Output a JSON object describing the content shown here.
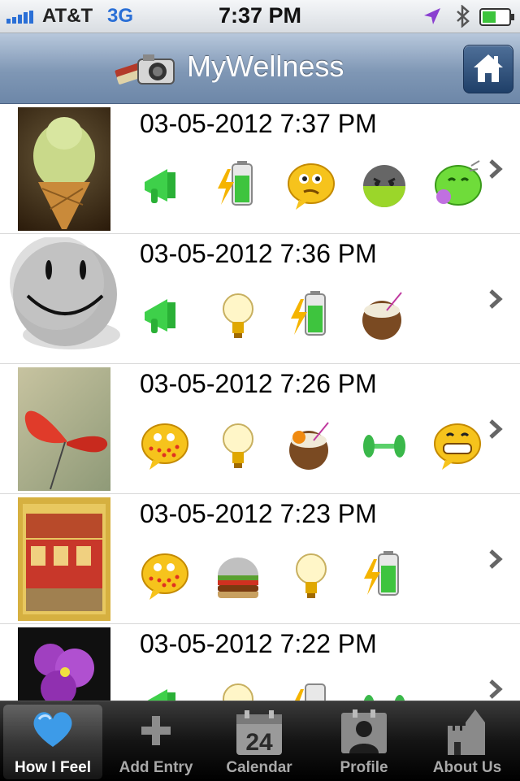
{
  "status_bar": {
    "carrier": "AT&T",
    "network": "3G",
    "time": "7:37 PM",
    "icons": [
      "signal-icon",
      "location-arrow-icon",
      "bluetooth-icon",
      "battery-icon"
    ]
  },
  "nav": {
    "title": "MyWellness",
    "home_icon": "home-icon",
    "logo_icon": "books-camera-logo"
  },
  "entries": [
    {
      "timestamp": "03-05-2012 7:37 PM",
      "thumbnail": "ice-cream-cone-photo",
      "icons": [
        "megaphone-icon",
        "battery-charge-icon",
        "thinking-face-icon",
        "sick-face-icon",
        "nauseous-face-icon"
      ]
    },
    {
      "timestamp": "03-05-2012 7:36 PM",
      "thumbnail": "smiley-ball-photo",
      "icons": [
        "megaphone-icon",
        "lightbulb-icon",
        "battery-charge-icon",
        "coconut-drink-icon"
      ]
    },
    {
      "timestamp": "03-05-2012 7:26 PM",
      "thumbnail": "butterfly-photo",
      "icons": [
        "spotted-face-icon",
        "lightbulb-icon",
        "coconut-drink-icon",
        "dumbbell-icon",
        "grinning-face-icon"
      ]
    },
    {
      "timestamp": "03-05-2012 7:23 PM",
      "thumbnail": "storefront-painting-photo",
      "icons": [
        "spotted-face-icon",
        "burger-icon",
        "lightbulb-icon",
        "battery-charge-icon"
      ]
    },
    {
      "timestamp": "03-05-2012 7:22 PM",
      "thumbnail": "purple-flower-photo",
      "icons": [
        "megaphone-icon",
        "lightbulb-icon",
        "battery-charge-icon",
        "dumbbell-icon"
      ]
    }
  ],
  "tabs": [
    {
      "label": "How I Feel",
      "icon": "heart-icon",
      "active": true
    },
    {
      "label": "Add Entry",
      "icon": "plus-icon",
      "active": false
    },
    {
      "label": "Calendar",
      "icon": "calendar-icon",
      "active": false
    },
    {
      "label": "Profile",
      "icon": "profile-icon",
      "active": false
    },
    {
      "label": "About Us",
      "icon": "castle-icon",
      "active": false
    }
  ],
  "colors": {
    "nav_gradient_top": "#b8c8dc",
    "nav_gradient_bottom": "#6d87a8",
    "active_tab_icon": "#3d9be8",
    "network_label": "#2a6fd6"
  }
}
